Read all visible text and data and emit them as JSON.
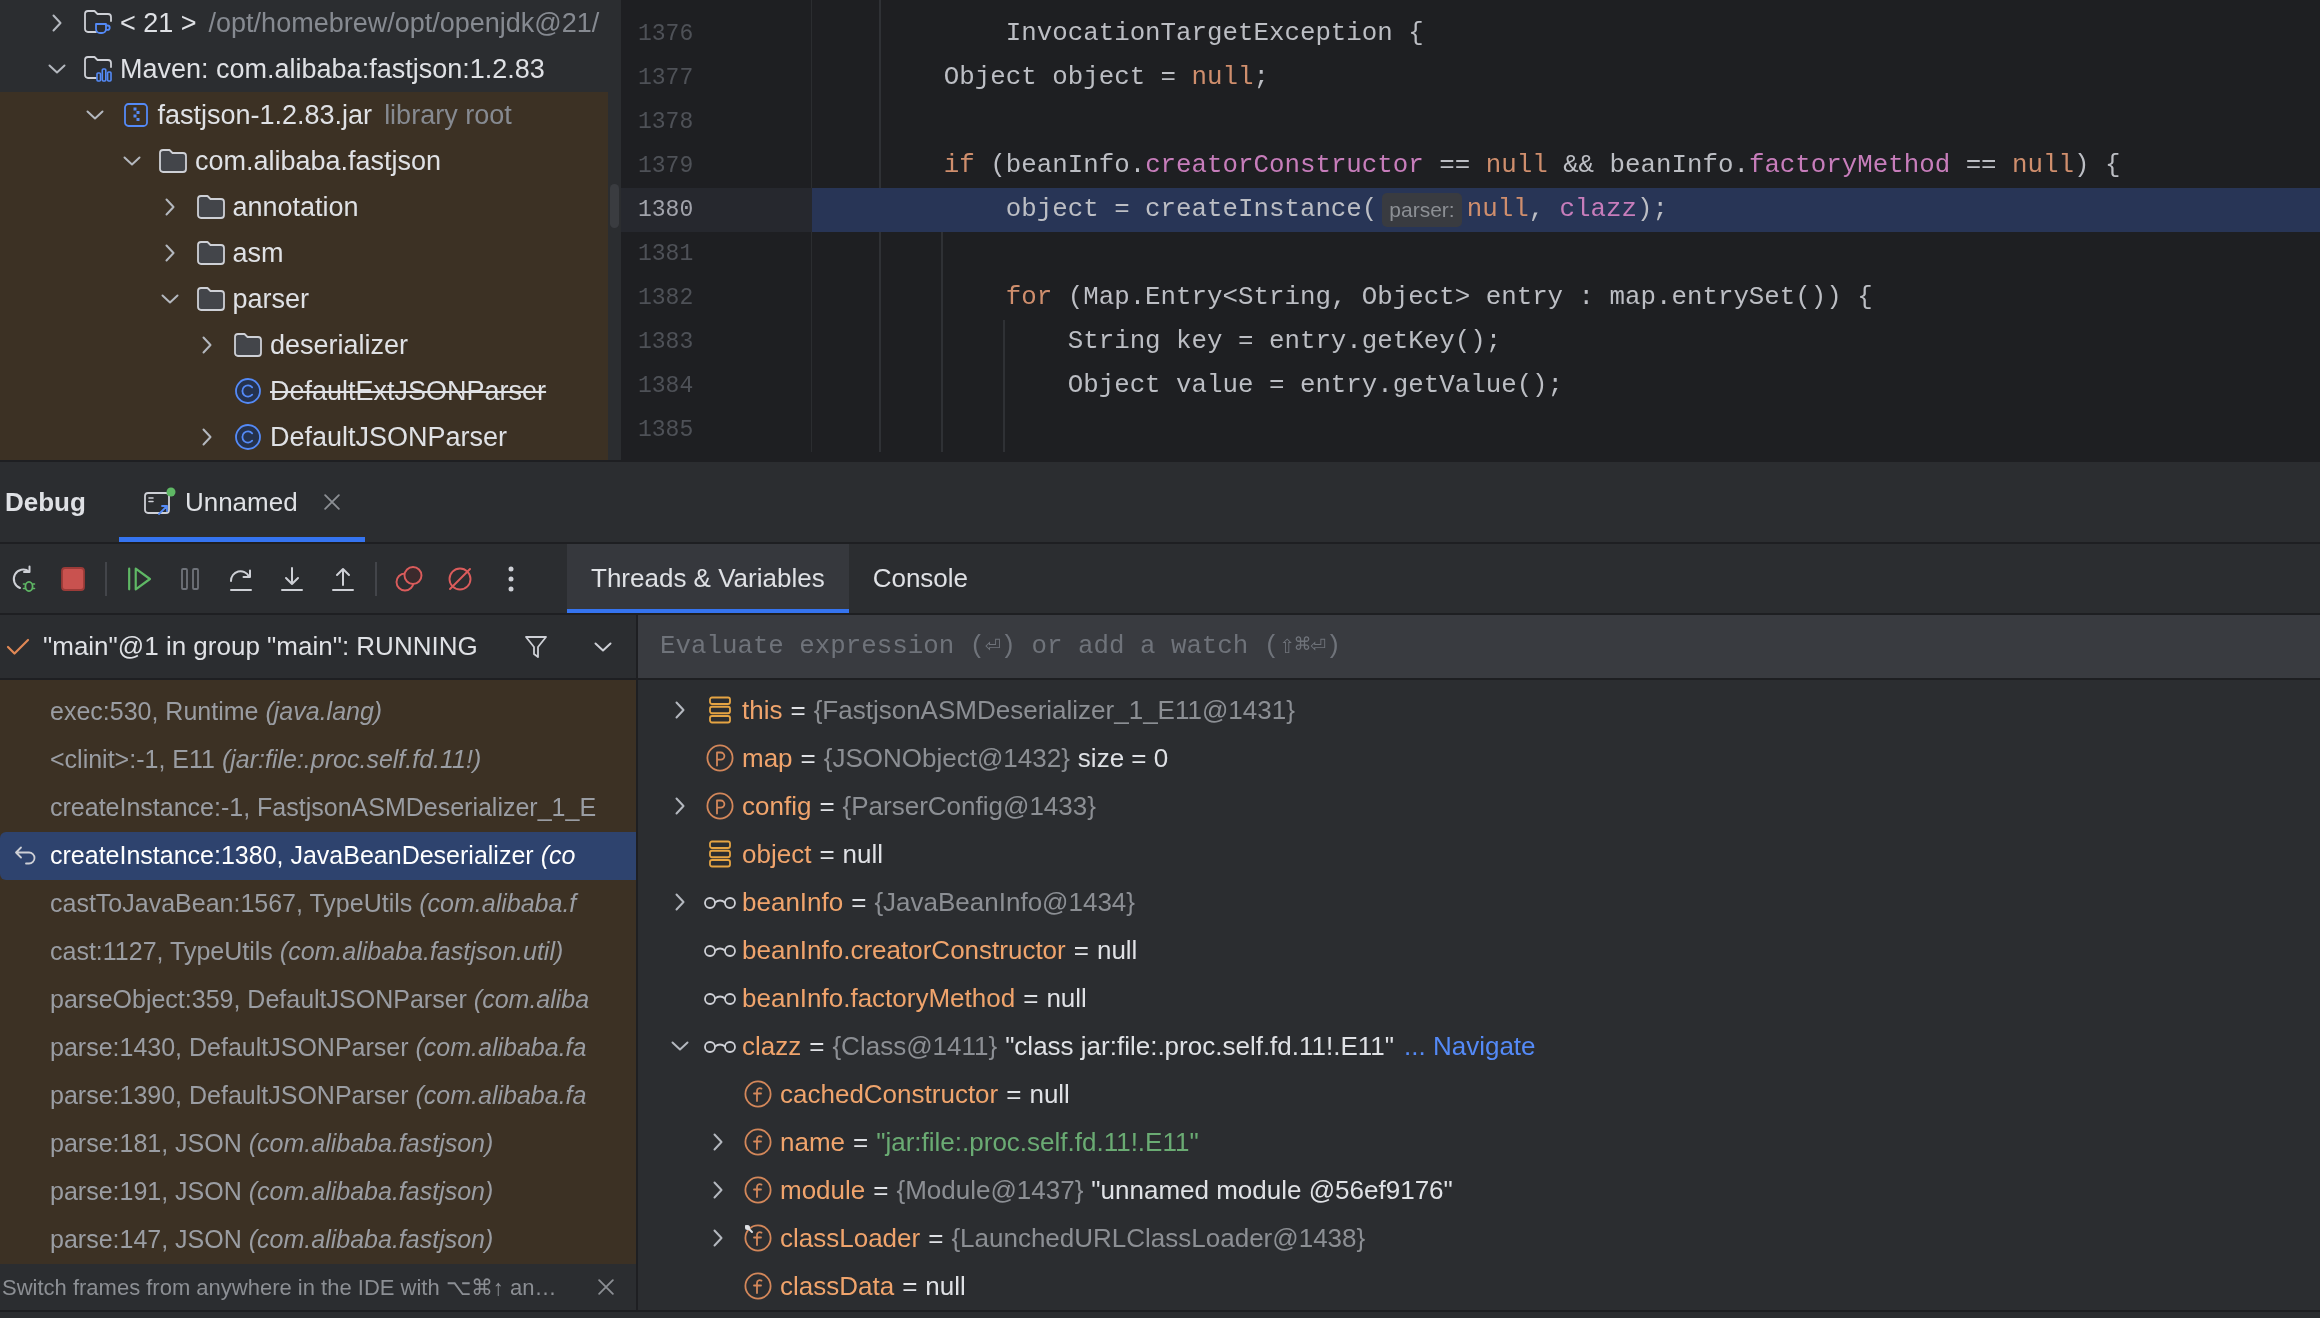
{
  "project_tree": {
    "items": [
      {
        "kind": "jdk",
        "label": "< 21 >",
        "hint": "/opt/homebrew/opt/openjdk@21/",
        "expanded": false,
        "tinted": false
      },
      {
        "kind": "library",
        "label": "Maven: com.alibaba:fastjson:1.2.83",
        "expanded": true,
        "tinted": false,
        "children": [
          {
            "kind": "jar",
            "label": "fastjson-1.2.83.jar",
            "hint": "library root",
            "expanded": true,
            "tinted": true,
            "children": [
              {
                "kind": "package",
                "label": "com.alibaba.fastjson",
                "expanded": true,
                "children": [
                  {
                    "kind": "package",
                    "label": "annotation",
                    "expanded": false
                  },
                  {
                    "kind": "package",
                    "label": "asm",
                    "expanded": false
                  },
                  {
                    "kind": "package",
                    "label": "parser",
                    "expanded": true,
                    "children": [
                      {
                        "kind": "package",
                        "label": "deserializer",
                        "expanded": false,
                        "deprecated": false
                      },
                      {
                        "kind": "class",
                        "label": "DefaultExtJSONParser",
                        "deprecated": true
                      },
                      {
                        "kind": "class",
                        "label": "DefaultJSONParser",
                        "expanded": false,
                        "deprecated": false
                      }
                    ]
                  }
                ]
              }
            ]
          }
        ]
      }
    ]
  },
  "editor": {
    "lines": [
      {
        "number": "1376",
        "current": false,
        "tokens": [
          {
            "kind": "plain",
            "text": "            InvocationTargetException {"
          }
        ]
      },
      {
        "number": "1377",
        "current": false,
        "tokens": [
          {
            "kind": "plain",
            "text": "        Object object = "
          },
          {
            "kind": "keyword",
            "text": "null"
          },
          {
            "kind": "plain",
            "text": ";"
          }
        ]
      },
      {
        "number": "1378",
        "current": false
      },
      {
        "number": "1379",
        "current": false,
        "tokens": [
          {
            "kind": "keyword",
            "text": "        if"
          },
          {
            "kind": "plain",
            "text": " (beanInfo."
          },
          {
            "kind": "field",
            "text": "creatorConstructor"
          },
          {
            "kind": "plain",
            "text": " == "
          },
          {
            "kind": "keyword",
            "text": "null"
          },
          {
            "kind": "plain",
            "text": " && beanInfo."
          },
          {
            "kind": "field",
            "text": "factoryMethod"
          },
          {
            "kind": "plain",
            "text": " == "
          },
          {
            "kind": "keyword",
            "text": "null"
          },
          {
            "kind": "plain",
            "text": ") {"
          }
        ]
      },
      {
        "number": "1380",
        "current": true,
        "tokens": [
          {
            "kind": "plain",
            "text": "            object = createInstance("
          },
          {
            "kind": "hint",
            "text": "parser:"
          },
          {
            "kind": "keyword",
            "text": "null"
          },
          {
            "kind": "plain",
            "text": ", "
          },
          {
            "kind": "field",
            "text": "clazz"
          },
          {
            "kind": "plain",
            "text": ");"
          }
        ]
      },
      {
        "number": "1381",
        "current": false
      },
      {
        "number": "1382",
        "current": false,
        "tokens": [
          {
            "kind": "keyword",
            "text": "            for"
          },
          {
            "kind": "plain",
            "text": " (Map.Entry<String, Object> entry : map.entrySet()) {"
          }
        ]
      },
      {
        "number": "1383",
        "current": false,
        "tokens": [
          {
            "kind": "plain",
            "text": "                String key = entry.getKey();"
          }
        ]
      },
      {
        "number": "1384",
        "current": false,
        "tokens": [
          {
            "kind": "plain",
            "text": "                Object value = entry.getValue();"
          }
        ]
      },
      {
        "number": "1385",
        "current": false
      }
    ]
  },
  "debug": {
    "title": "Debug",
    "sessions": [
      {
        "label": "Unnamed",
        "selected": true,
        "running": true
      }
    ],
    "toolbar": {
      "groups": [
        [
          {
            "kind": "rerun",
            "disabled": false
          },
          {
            "kind": "stop",
            "disabled": false
          }
        ],
        [
          {
            "kind": "resume",
            "disabled": false
          },
          {
            "kind": "pause",
            "disabled": true
          },
          {
            "kind": "step_over",
            "disabled": false
          },
          {
            "kind": "step_into",
            "disabled": false
          },
          {
            "kind": "step_out",
            "disabled": false
          }
        ],
        [
          {
            "kind": "view_breakpoints",
            "disabled": false
          },
          {
            "kind": "mute_breakpoints",
            "disabled": false
          },
          {
            "kind": "more",
            "disabled": false
          }
        ]
      ]
    },
    "tabs": [
      {
        "label": "Threads & Variables",
        "selected": true
      },
      {
        "label": "Console",
        "selected": false
      }
    ],
    "thread": {
      "label": "\"main\"@1 in group \"main\": RUNNING"
    },
    "frames": [
      {
        "method": "exec:530, Runtime",
        "package": "(java.lang)",
        "selected": false
      },
      {
        "method": "<clinit>:-1, E11",
        "package": "(jar:file:.proc.self.fd.11!)",
        "selected": false
      },
      {
        "method": "createInstance:-1, FastjsonASMDeserializer_1_E",
        "selected": false
      },
      {
        "method": "createInstance:1380, JavaBeanDeserializer",
        "package": "(co",
        "selected": true
      },
      {
        "method": "castToJavaBean:1567, TypeUtils",
        "package": "(com.alibaba.f",
        "selected": false
      },
      {
        "method": "cast:1127, TypeUtils",
        "package": "(com.alibaba.fastjson.util)",
        "selected": false
      },
      {
        "method": "parseObject:359, DefaultJSONParser",
        "package": "(com.aliba",
        "selected": false
      },
      {
        "method": "parse:1430, DefaultJSONParser",
        "package": "(com.alibaba.fa",
        "selected": false
      },
      {
        "method": "parse:1390, DefaultJSONParser",
        "package": "(com.alibaba.fa",
        "selected": false
      },
      {
        "method": "parse:181, JSON",
        "package": "(com.alibaba.fastjson)",
        "selected": false
      },
      {
        "method": "parse:191, JSON",
        "package": "(com.alibaba.fastjson)",
        "selected": false
      },
      {
        "method": "parse:147, JSON",
        "package": "(com.alibaba.fastjson)",
        "selected": false
      }
    ],
    "hint": {
      "text": "Switch frames from anywhere in the IDE with ⌥⌘↑ an…"
    },
    "evaluate": {
      "placeholder": "Evaluate expression (⏎) or add a watch (⇧⌘⏎)"
    },
    "variables": [
      {
        "kind": "local",
        "expanded": false,
        "parts": [
          {
            "kind": "name",
            "text": "this"
          },
          {
            "kind": "op",
            "text": "="
          },
          {
            "kind": "ref",
            "text": "{FastjsonASMDeserializer_1_E11@1431}"
          }
        ]
      },
      {
        "kind": "parameter",
        "parts": [
          {
            "kind": "name",
            "text": "map"
          },
          {
            "kind": "op",
            "text": "="
          },
          {
            "kind": "ref",
            "text": "{JSONObject@1432}"
          },
          {
            "kind": "value",
            "text": "size = 0"
          }
        ]
      },
      {
        "kind": "parameter",
        "expanded": false,
        "parts": [
          {
            "kind": "name",
            "text": "config"
          },
          {
            "kind": "op",
            "text": "="
          },
          {
            "kind": "ref",
            "text": "{ParserConfig@1433}"
          }
        ]
      },
      {
        "kind": "local",
        "parts": [
          {
            "kind": "name",
            "text": "object"
          },
          {
            "kind": "op",
            "text": "="
          },
          {
            "kind": "value",
            "text": "null"
          }
        ]
      },
      {
        "kind": "watch",
        "expanded": false,
        "parts": [
          {
            "kind": "name",
            "text": "beanInfo"
          },
          {
            "kind": "op",
            "text": "="
          },
          {
            "kind": "ref",
            "text": "{JavaBeanInfo@1434}"
          }
        ]
      },
      {
        "kind": "watch",
        "parts": [
          {
            "kind": "name",
            "text": "beanInfo.creatorConstructor"
          },
          {
            "kind": "op",
            "text": "="
          },
          {
            "kind": "value",
            "text": "null"
          }
        ]
      },
      {
        "kind": "watch",
        "parts": [
          {
            "kind": "name",
            "text": "beanInfo.factoryMethod"
          },
          {
            "kind": "op",
            "text": "="
          },
          {
            "kind": "value",
            "text": "null"
          }
        ]
      },
      {
        "kind": "watch",
        "expanded": true,
        "parts": [
          {
            "kind": "name",
            "text": "clazz"
          },
          {
            "kind": "op",
            "text": "="
          },
          {
            "kind": "ref",
            "text": "{Class@1411}"
          },
          {
            "kind": "value",
            "text": "\"class jar:file:.proc.self.fd.11!.E11\""
          },
          {
            "kind": "link",
            "text": "... Navigate"
          }
        ],
        "children": [
          {
            "kind": "field",
            "badge": false,
            "parts": [
              {
                "kind": "name",
                "text": "cachedConstructor"
              },
              {
                "kind": "op",
                "text": "="
              },
              {
                "kind": "value",
                "text": "null"
              }
            ]
          },
          {
            "kind": "field",
            "badge": false,
            "expanded": false,
            "parts": [
              {
                "kind": "name",
                "text": "name"
              },
              {
                "kind": "op",
                "text": "="
              },
              {
                "kind": "string",
                "text": "\"jar:file:.proc.self.fd.11!.E11\""
              }
            ]
          },
          {
            "kind": "field",
            "badge": false,
            "expanded": false,
            "parts": [
              {
                "kind": "name",
                "text": "module"
              },
              {
                "kind": "op",
                "text": "="
              },
              {
                "kind": "ref",
                "text": "{Module@1437}"
              },
              {
                "kind": "value",
                "text": "\"unnamed module @56ef9176\""
              }
            ]
          },
          {
            "kind": "field",
            "badge": true,
            "expanded": false,
            "parts": [
              {
                "kind": "name",
                "text": "classLoader"
              },
              {
                "kind": "op",
                "text": "="
              },
              {
                "kind": "ref",
                "text": "{LaunchedURLClassLoader@1438}"
              }
            ]
          },
          {
            "kind": "field",
            "badge": false,
            "parts": [
              {
                "kind": "name",
                "text": "classData"
              },
              {
                "kind": "op",
                "text": "="
              },
              {
                "kind": "value",
                "text": "null"
              }
            ]
          }
        ]
      }
    ]
  }
}
